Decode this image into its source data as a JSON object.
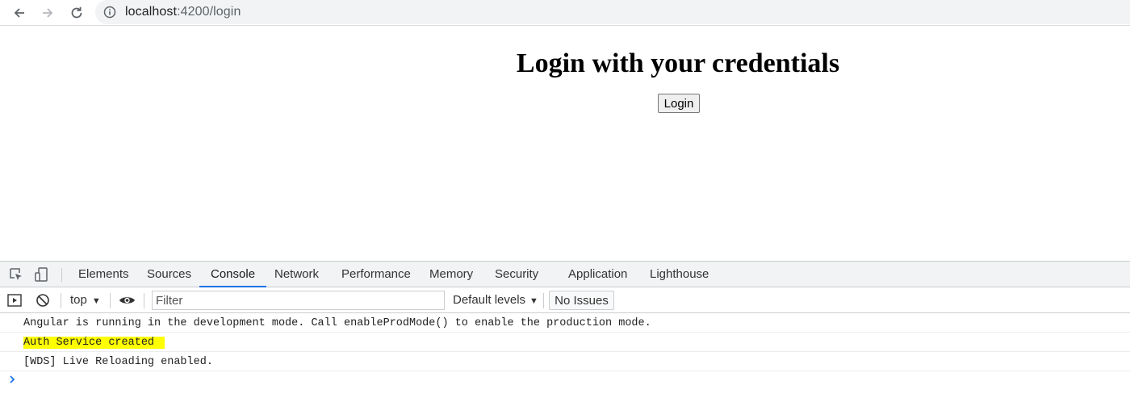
{
  "browser": {
    "url_host": "localhost",
    "url_path": ":4200/login"
  },
  "page": {
    "title": "Login with your credentials",
    "login_button": "Login"
  },
  "devtools": {
    "tabs": [
      {
        "label": "Elements"
      },
      {
        "label": "Sources"
      },
      {
        "label": "Console",
        "active": true
      },
      {
        "label": "Network"
      },
      {
        "label": "Performance"
      },
      {
        "label": "Memory"
      },
      {
        "label": "Security"
      },
      {
        "label": "Application"
      },
      {
        "label": "Lighthouse"
      }
    ],
    "toolbar": {
      "context": "top",
      "filter_placeholder": "Filter",
      "levels": "Default levels",
      "issues": "No Issues"
    },
    "messages": [
      {
        "text": "Angular is running in the development mode. Call enableProdMode() to enable the production mode."
      },
      {
        "text": "Auth Service created",
        "highlight_color": "#ffff00"
      },
      {
        "text": "[WDS] Live Reloading enabled."
      }
    ],
    "colors": {
      "active_tab_underline": "#1a73e8",
      "prompt": "#1a73e8"
    }
  }
}
